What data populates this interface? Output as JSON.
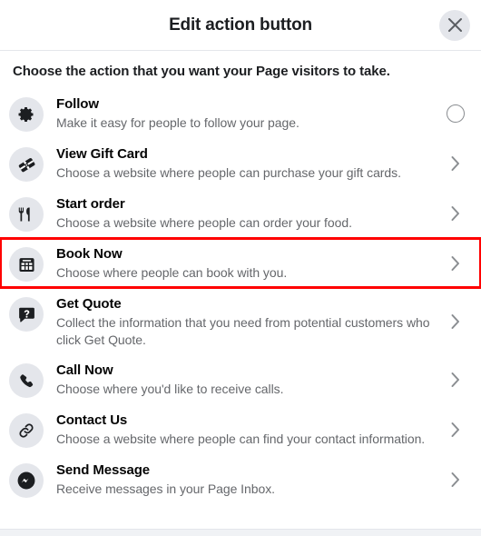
{
  "header": {
    "title": "Edit action button",
    "close_label": "Close",
    "close_icon": "close-icon"
  },
  "subtitle": "Choose the action that you want your Page visitors to take.",
  "colors": {
    "highlight_border": "#ff0000",
    "icon_bg": "#e4e6eb",
    "title_text": "#050505",
    "desc_text": "#65676b",
    "chevron": "#8a8d91"
  },
  "actions": [
    {
      "title": "Follow",
      "description": "Make it easy for people to follow your page.",
      "icon": "gear-icon",
      "control": "radio",
      "selected": false,
      "highlighted": false
    },
    {
      "title": "View Gift Card",
      "description": "Choose a website where people can purchase your gift cards.",
      "icon": "gift-card-icon",
      "control": "chevron",
      "selected": false,
      "highlighted": false
    },
    {
      "title": "Start order",
      "description": "Choose a website where people can order your food.",
      "icon": "fork-knife-icon",
      "control": "chevron",
      "selected": false,
      "highlighted": false
    },
    {
      "title": "Book Now",
      "description": "Choose where people can book with you.",
      "icon": "calendar-icon",
      "control": "chevron",
      "selected": false,
      "highlighted": true
    },
    {
      "title": "Get Quote",
      "description": "Collect the information that you need from potential customers who click Get Quote.",
      "icon": "question-bubble-icon",
      "control": "chevron",
      "selected": false,
      "highlighted": false
    },
    {
      "title": "Call Now",
      "description": "Choose where you'd like to receive calls.",
      "icon": "phone-icon",
      "control": "chevron",
      "selected": false,
      "highlighted": false
    },
    {
      "title": "Contact Us",
      "description": "Choose a website where people can find your contact information.",
      "icon": "link-icon",
      "control": "chevron",
      "selected": false,
      "highlighted": false
    },
    {
      "title": "Send Message",
      "description": "Receive messages in your Page Inbox.",
      "icon": "messenger-icon",
      "control": "chevron",
      "selected": false,
      "highlighted": false
    }
  ]
}
